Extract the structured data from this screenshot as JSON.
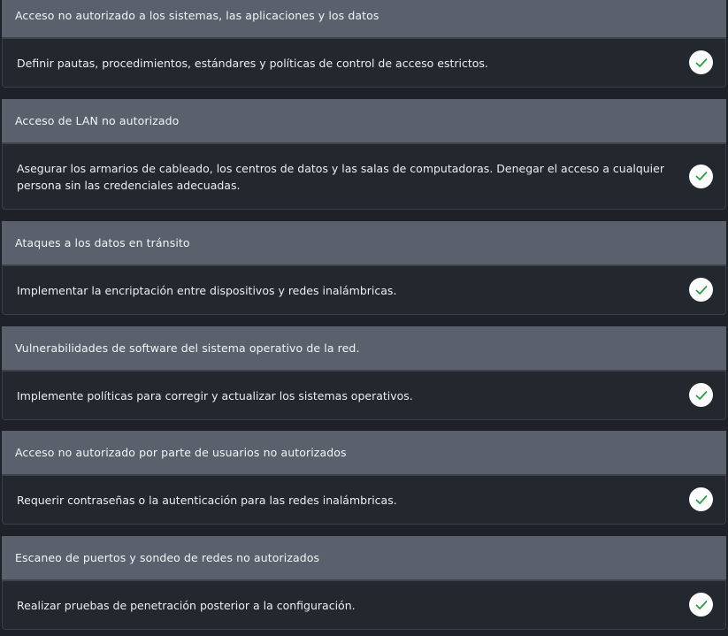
{
  "items": [
    {
      "threat": "Acceso no autorizado a los sistemas, las aplicaciones y los datos",
      "mitigation": "Definir pautas, procedimientos, estándares y políticas de control de acceso estrictos.",
      "status_icon": "checkmark-circle-icon"
    },
    {
      "threat": "Acceso de LAN no autorizado",
      "mitigation": "Asegurar los armarios de cableado, los centros de datos y las salas de computadoras. Denegar el acceso a cualquier persona sin las credenciales adecuadas.",
      "status_icon": "checkmark-circle-icon"
    },
    {
      "threat": "Ataques a los datos en tránsito",
      "mitigation": "Implementar la encriptación entre dispositivos y redes inalámbricas.",
      "status_icon": "checkmark-circle-icon"
    },
    {
      "threat": "Vulnerabilidades de software del sistema operativo de la red.",
      "mitigation": "Implemente políticas para corregir y actualizar los sistemas operativos.",
      "status_icon": "checkmark-circle-icon"
    },
    {
      "threat": "Acceso no autorizado por parte de usuarios no autorizados",
      "mitigation": "Requerir contraseñas o la autenticación para las redes inalámbricas.",
      "status_icon": "checkmark-circle-icon"
    },
    {
      "threat": "Escaneo de puertos y sondeo de redes no autorizados",
      "mitigation": "Realizar pruebas de penetración posterior a la configuración.",
      "status_icon": "checkmark-circle-icon"
    }
  ],
  "colors": {
    "page_background": "#1e2127",
    "header_background": "#5a616d",
    "body_background": "#23272e",
    "check_background": "#ffffff",
    "check_mark": "#2e9e46"
  }
}
